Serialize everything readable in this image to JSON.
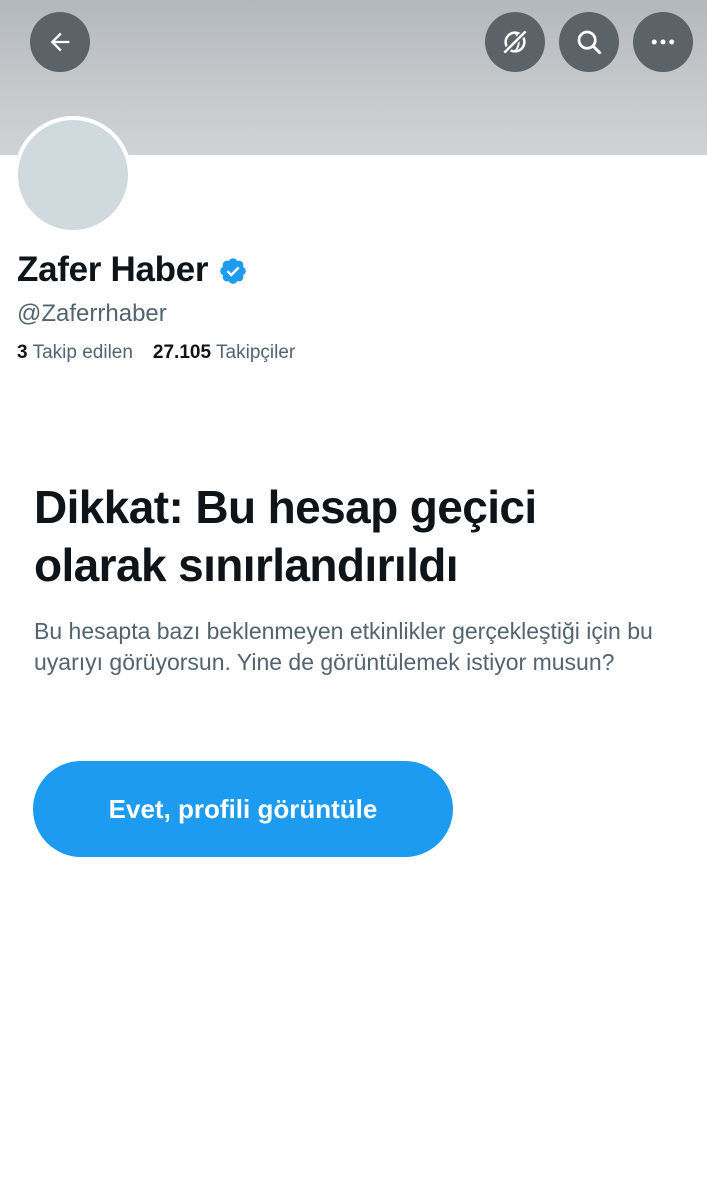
{
  "header": {
    "back_icon": "back-arrow-icon",
    "translate_icon": "globe-slash-icon",
    "search_icon": "search-icon",
    "more_icon": "more-dots-icon"
  },
  "profile": {
    "display_name": "Zafer Haber",
    "verified": true,
    "handle": "@Zaferrhaber",
    "following_count": "3",
    "following_label": "Takip edilen",
    "followers_count": "27.105",
    "followers_label": "Takipçiler"
  },
  "warning": {
    "title": "Dikkat: Bu hesap geçici olarak sınırlandırıldı",
    "body": "Bu hesapta bazı beklenmeyen etkinlikler gerçekleştiği için bu uyarıyı görüyorsun. Yine de görüntülemek istiyor musun?",
    "button_label": "Evet, profili görüntüle"
  },
  "colors": {
    "accent": "#1d9bf0",
    "text_primary": "#0f1419",
    "text_secondary": "#536471",
    "icon_button_bg": "#5b6268",
    "avatar_placeholder": "#cfd9de"
  }
}
